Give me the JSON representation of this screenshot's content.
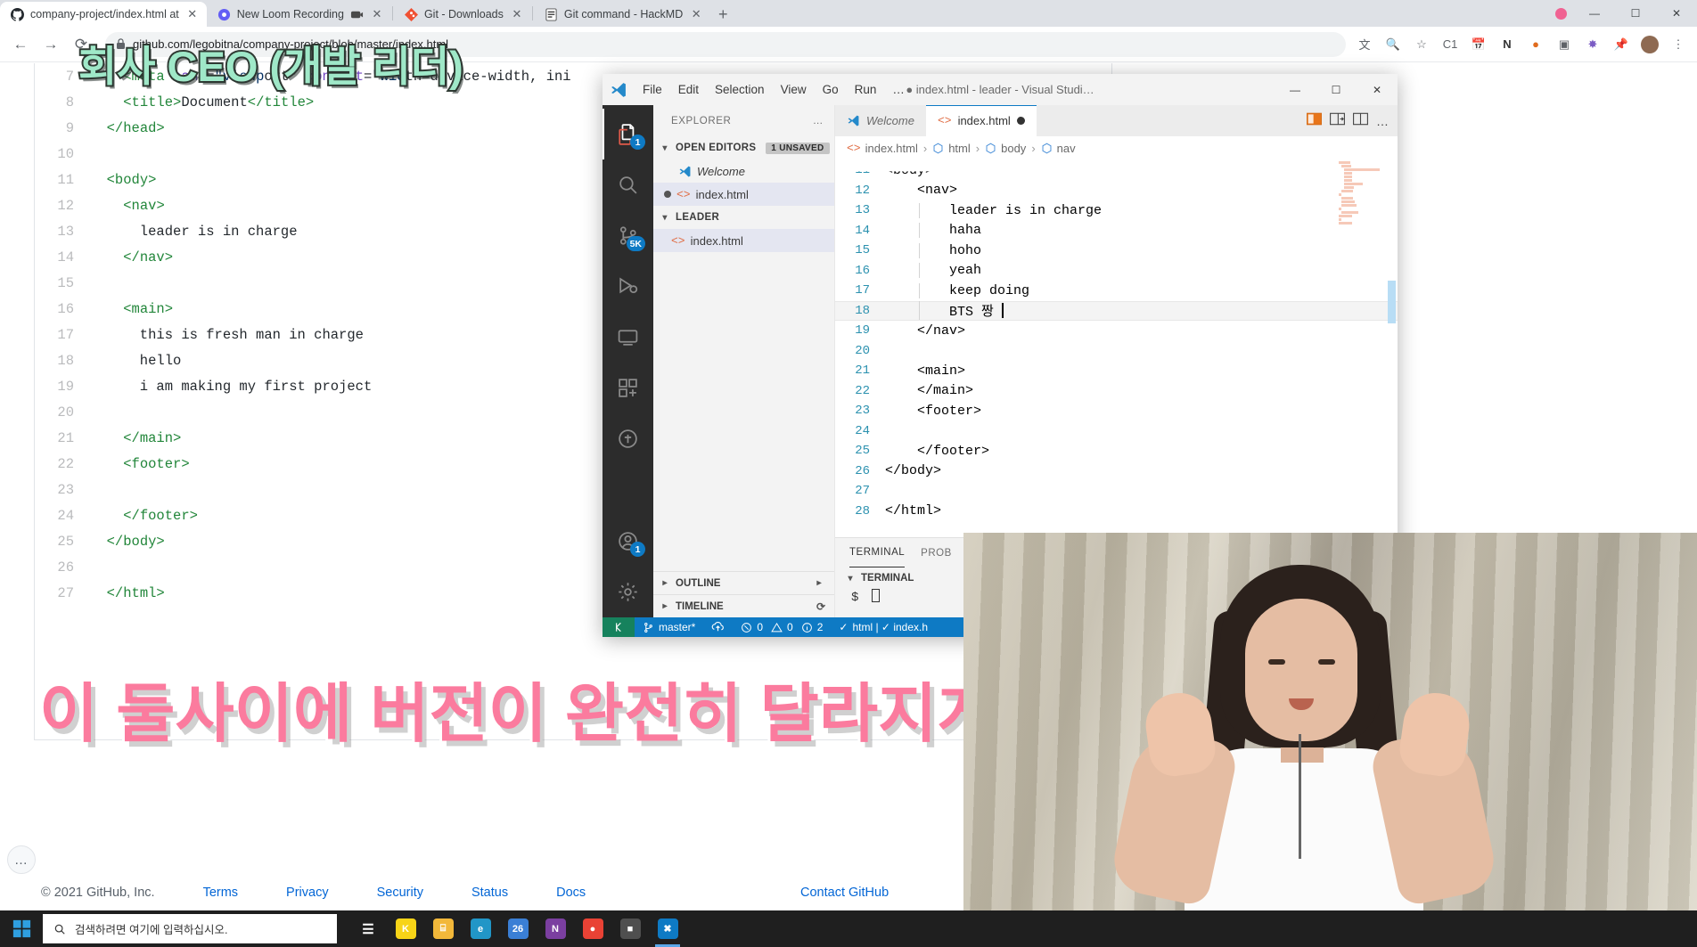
{
  "browser": {
    "tabs": [
      {
        "title": "company-project/index.html at",
        "icon": "github-icon",
        "active": true
      },
      {
        "title": "New Loom Recording",
        "icon": "loom-icon",
        "active": false
      },
      {
        "title": "Git - Downloads",
        "icon": "git-icon",
        "active": false
      },
      {
        "title": "Git command - HackMD",
        "icon": "hackmd-icon",
        "active": false
      }
    ],
    "new_tab_label": "+",
    "window_controls": [
      "—",
      "☐",
      "✕"
    ],
    "nav": {
      "back": "←",
      "forward": "→",
      "reload": "⟳"
    },
    "url": "github.com/legobitna/company-project/blob/master/index.html",
    "lock_icon": "lock-icon",
    "toolbar_icons": [
      "translate-icon",
      "zoom-icon",
      "star-icon",
      "c1-extension-icon",
      "calendar-extension-icon",
      "notion-extension-icon",
      "paint-extension-icon",
      "screenshot-extension-icon",
      "puzzle-extension-icon",
      "pin-extension-icon",
      "avatar-icon",
      "menu-icon"
    ]
  },
  "github": {
    "code_lines": [
      {
        "n": "7",
        "indent": 4,
        "code": "<meta name=\"viewport\" content=\"width=device-width, ini"
      },
      {
        "n": "8",
        "indent": 4,
        "code": "<title>Document</title>"
      },
      {
        "n": "9",
        "indent": 2,
        "code": "</head>"
      },
      {
        "n": "10",
        "indent": 0,
        "code": ""
      },
      {
        "n": "11",
        "indent": 2,
        "code": "<body>"
      },
      {
        "n": "12",
        "indent": 4,
        "code": "<nav>"
      },
      {
        "n": "13",
        "indent": 6,
        "code": "leader is in charge"
      },
      {
        "n": "14",
        "indent": 4,
        "code": "</nav>"
      },
      {
        "n": "15",
        "indent": 0,
        "code": ""
      },
      {
        "n": "16",
        "indent": 4,
        "code": "<main>"
      },
      {
        "n": "17",
        "indent": 6,
        "code": "this is fresh man in charge"
      },
      {
        "n": "18",
        "indent": 6,
        "code": "hello"
      },
      {
        "n": "19",
        "indent": 6,
        "code": "i am making my first project"
      },
      {
        "n": "20",
        "indent": 0,
        "code": ""
      },
      {
        "n": "21",
        "indent": 4,
        "code": "</main>"
      },
      {
        "n": "22",
        "indent": 4,
        "code": "<footer>"
      },
      {
        "n": "23",
        "indent": 0,
        "code": ""
      },
      {
        "n": "24",
        "indent": 4,
        "code": "</footer>"
      },
      {
        "n": "25",
        "indent": 2,
        "code": "</body>"
      },
      {
        "n": "26",
        "indent": 0,
        "code": ""
      },
      {
        "n": "27",
        "indent": 2,
        "code": "</html>"
      }
    ],
    "footer": {
      "copyright": "© 2021 GitHub, Inc.",
      "links": [
        "Terms",
        "Privacy",
        "Security",
        "Status",
        "Docs"
      ],
      "contact": "Contact GitHub"
    },
    "more_button": "…"
  },
  "captions": {
    "top": "회사 CEO (개발 리더)",
    "bottom": "이 둘사이에 버전이 완전히 달라지게 됩니다",
    "top_color": "#9fe8c8",
    "bottom_color": "#fb7b9e"
  },
  "vscode": {
    "window_title": "● index.html - leader - Visual Studi…",
    "menu": [
      "File",
      "Edit",
      "Selection",
      "View",
      "Go",
      "Run",
      "…"
    ],
    "window_controls": [
      "—",
      "☐",
      "✕"
    ],
    "activity_bar": [
      {
        "name": "explorer-icon",
        "badge": "1",
        "active": true
      },
      {
        "name": "search-icon",
        "badge": "",
        "active": false
      },
      {
        "name": "source-control-icon",
        "badge": "5K",
        "active": false
      },
      {
        "name": "run-debug-icon",
        "badge": "",
        "active": false
      },
      {
        "name": "remote-explorer-icon",
        "badge": "",
        "active": false
      },
      {
        "name": "extensions-icon",
        "badge": "",
        "active": false
      },
      {
        "name": "live-share-icon",
        "badge": "",
        "active": false
      }
    ],
    "activity_bottom": [
      {
        "name": "accounts-icon",
        "badge": "1"
      },
      {
        "name": "settings-gear-icon",
        "badge": ""
      }
    ],
    "sidebar": {
      "header": "EXPLORER",
      "header_more": "…",
      "open_editors": {
        "label": "OPEN EDITORS",
        "badge": "1 UNSAVED"
      },
      "open_editor_items": [
        {
          "label": "Welcome",
          "icon": "vscode-icon",
          "unsaved": false,
          "selected": false
        },
        {
          "label": "index.html",
          "icon": "html-icon",
          "unsaved": true,
          "selected": true
        }
      ],
      "folder": {
        "label": "LEADER"
      },
      "folder_items": [
        {
          "label": "index.html",
          "icon": "html-icon",
          "selected": true
        }
      ],
      "bottom_sections": [
        "OUTLINE",
        "TIMELINE"
      ]
    },
    "tabs": [
      {
        "label": "Welcome",
        "icon": "vscode-icon",
        "active": false,
        "unsaved": false
      },
      {
        "label": "index.html",
        "icon": "html-icon",
        "active": true,
        "unsaved": true
      }
    ],
    "tab_actions": [
      "split-preview-icon",
      "open-preview-icon",
      "split-editor-icon",
      "more-actions-icon"
    ],
    "breadcrumb": [
      "index.html",
      "html",
      "body",
      "nav"
    ],
    "editor_lines": [
      {
        "n": "11",
        "code": "<body>",
        "partial": true,
        "current": false
      },
      {
        "n": "12",
        "code": "    <nav>",
        "partial": false,
        "current": false
      },
      {
        "n": "13",
        "code": "        leader is in charge",
        "partial": false,
        "current": false
      },
      {
        "n": "14",
        "code": "        haha",
        "partial": false,
        "current": false,
        "squiggle": true
      },
      {
        "n": "15",
        "code": "        hoho",
        "partial": false,
        "current": false,
        "squiggle": true
      },
      {
        "n": "16",
        "code": "        yeah",
        "partial": false,
        "current": false
      },
      {
        "n": "17",
        "code": "        keep doing",
        "partial": false,
        "current": false
      },
      {
        "n": "18",
        "code": "        BTS 짱 ",
        "partial": false,
        "current": true,
        "caret": true
      },
      {
        "n": "19",
        "code": "    </nav>",
        "partial": false,
        "current": false
      },
      {
        "n": "20",
        "code": "",
        "partial": false,
        "current": false
      },
      {
        "n": "21",
        "code": "    <main>",
        "partial": false,
        "current": false
      },
      {
        "n": "22",
        "code": "    </main>",
        "partial": false,
        "current": false
      },
      {
        "n": "23",
        "code": "    <footer>",
        "partial": false,
        "current": false
      },
      {
        "n": "24",
        "code": "",
        "partial": false,
        "current": false
      },
      {
        "n": "25",
        "code": "    </footer>",
        "partial": false,
        "current": false
      },
      {
        "n": "26",
        "code": "</body>",
        "partial": false,
        "current": false
      },
      {
        "n": "27",
        "code": "",
        "partial": false,
        "current": false
      },
      {
        "n": "28",
        "code": "</html>",
        "partial": false,
        "current": false
      }
    ],
    "panel": {
      "tabs": [
        "TERMINAL",
        "PROB"
      ],
      "active_tab": "TERMINAL",
      "terminal_label": "TERMINAL",
      "prompt": "$"
    },
    "status_bar": {
      "remote_icon": "remote-window-icon",
      "branch": "master*",
      "sync_icon": "sync-changes-icon",
      "errors": "0",
      "warnings": "0",
      "info": "2",
      "validations": "html | ✓ index.h"
    },
    "accent_color": "#0e7ac4"
  },
  "taskbar": {
    "start_icon": "windows-start-icon",
    "search_placeholder": "검색하려면 여기에 입력하십시오.",
    "search_icon": "search-icon",
    "items": [
      {
        "name": "task-view-icon",
        "label": "☰",
        "color": "#1f1f1f"
      },
      {
        "name": "kakaotalk-icon",
        "label": "K",
        "color": "#f7d417"
      },
      {
        "name": "file-explorer-icon",
        "label": "⌸",
        "color": "#f2b83a"
      },
      {
        "name": "edge-icon",
        "label": "e",
        "color": "#2196c7"
      },
      {
        "name": "notepad-icon",
        "label": "26",
        "color": "#3a7fd5"
      },
      {
        "name": "onenote-icon",
        "label": "N",
        "color": "#7b3fa0"
      },
      {
        "name": "chrome-icon",
        "label": "●",
        "color": "#e94235"
      },
      {
        "name": "loom-icon",
        "label": "■",
        "color": "#4f4f4f"
      },
      {
        "name": "vscode-icon",
        "label": "✖",
        "color": "#0e7ac4"
      }
    ]
  }
}
